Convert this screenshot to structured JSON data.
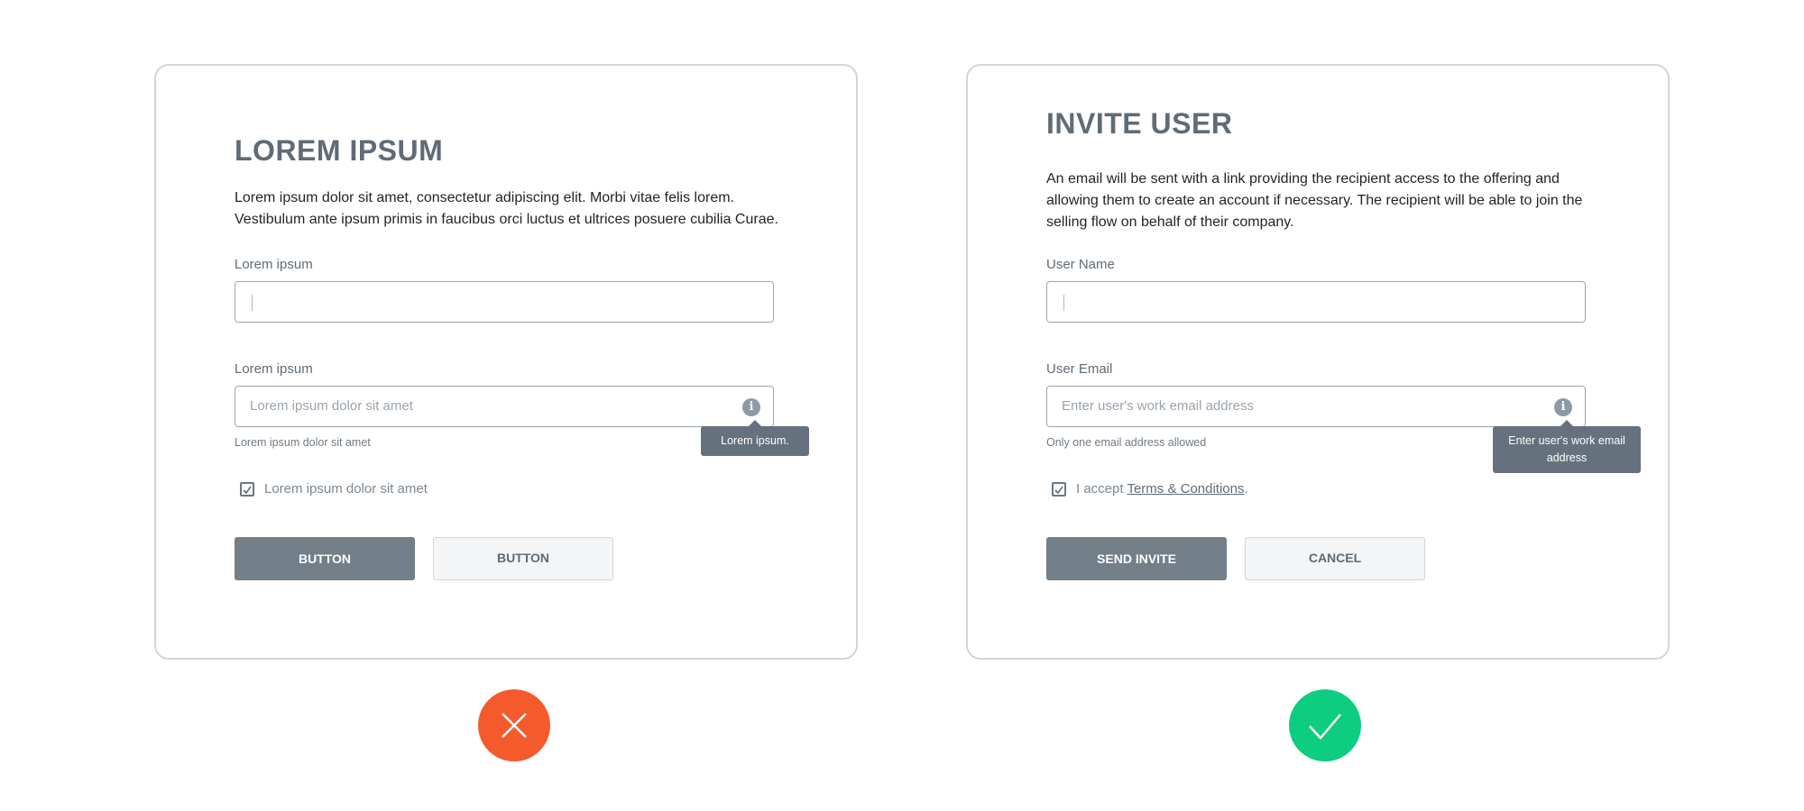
{
  "bad_example": {
    "title": "LOREM IPSUM",
    "description": "Lorem ipsum dolor sit amet, consectetur adipiscing elit. Morbi vitae felis lorem. Vestibulum ante ipsum primis in faucibus orci luctus et ultrices posuere cubilia Curae.",
    "field1": {
      "label": "Lorem ipsum",
      "value": ""
    },
    "field2": {
      "label": "Lorem ipsum",
      "placeholder": "Lorem ipsum dolor sit amet",
      "helper": "Lorem ipsum dolor sit amet",
      "tooltip": "Lorem ipsum.",
      "icon": "info-icon"
    },
    "checkbox": {
      "label": "Lorem ipsum dolor sit amet",
      "checked": true
    },
    "primary_button": "BUTTON",
    "secondary_button": "BUTTON",
    "verdict_icon": "x-icon",
    "verdict_color": "#f55a2c"
  },
  "good_example": {
    "title": "INVITE USER",
    "description": "An email will be sent with a link providing the recipient access to the offering and allowing them to create an account if necessary. The recipient will be able to join the selling flow on behalf of their company.",
    "field1": {
      "label": "User Name",
      "value": ""
    },
    "field2": {
      "label": "User Email",
      "placeholder": "Enter user's work email address",
      "helper": "Only one email address allowed",
      "tooltip": "Enter user's work email address",
      "icon": "info-icon"
    },
    "checkbox": {
      "label_prefix": "I accept ",
      "link": "Terms & Conditions",
      "label_suffix": ".",
      "checked": true
    },
    "primary_button": "SEND INVITE",
    "secondary_button": "CANCEL",
    "verdict_icon": "check-icon",
    "verdict_color": "#0dcd80"
  }
}
